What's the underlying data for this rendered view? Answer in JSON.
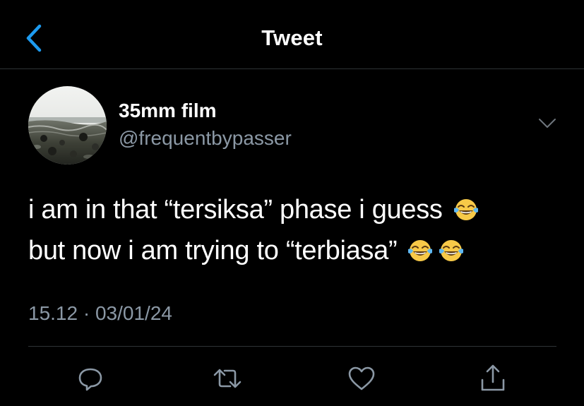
{
  "header": {
    "back_icon": "chevron-left-icon",
    "title": "Tweet"
  },
  "author": {
    "display_name": "35mm film",
    "handle": "@frequentbypasser",
    "avatar": "seaside-photo-avatar"
  },
  "tweet": {
    "line1": "i am in that “tersiksa” phase i guess",
    "line2": "but now i am trying to “terbiasa”",
    "emoji": "face-with-tears-of-joy",
    "line1_emoji_count": 1,
    "line2_emoji_count": 2
  },
  "meta": {
    "time": "15.12",
    "separator": " · ",
    "date": "03/01/24"
  },
  "actions": [
    "reply-icon",
    "retweet-icon",
    "like-icon",
    "share-icon"
  ],
  "colors": {
    "background": "#000000",
    "accent": "#1d9bf0",
    "secondary_text": "#8b98a5",
    "divider": "#2f3336"
  }
}
